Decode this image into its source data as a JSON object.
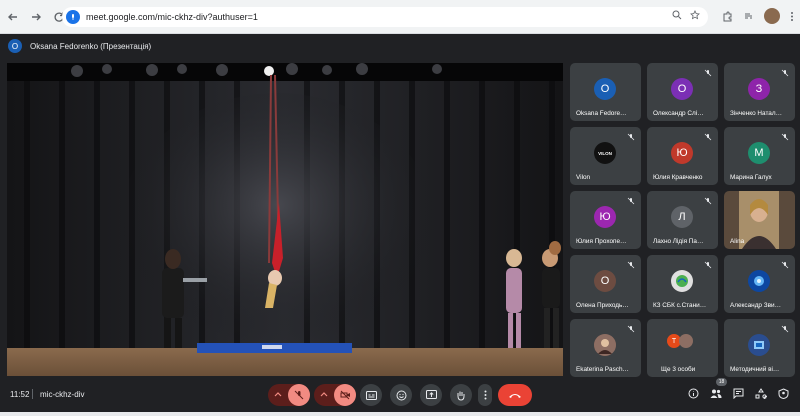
{
  "browser": {
    "url": "meet.google.com/mic-ckhz-div?authuser=1",
    "back_icon": "arrow-left-icon",
    "forward_icon": "arrow-right-icon",
    "reload_icon": "reload-icon"
  },
  "presenter": {
    "initial": "O",
    "label": "Oksana Fedorenko (Презентація)"
  },
  "participants": [
    {
      "initial": "O",
      "name": "Oksana Fedore…",
      "color": "#1a5fb4",
      "muted": false
    },
    {
      "initial": "O",
      "name": "Олександр Слі…",
      "color": "#7b2fb5",
      "muted": true
    },
    {
      "initial": "З",
      "name": "Зінченко Натал…",
      "color": "#8e24aa",
      "muted": true
    },
    {
      "initial": "VILON",
      "name": "Vilon",
      "color": "#111111",
      "muted": true
    },
    {
      "initial": "Ю",
      "name": "Юлия Кравченко",
      "color": "#c0392b",
      "muted": true
    },
    {
      "initial": "М",
      "name": "Марина Галух",
      "color": "#1e8e6e",
      "muted": true
    },
    {
      "initial": "Ю",
      "name": "Юлия Прохопе…",
      "color": "#9c27b0",
      "muted": true
    },
    {
      "initial": "Л",
      "name": "Лахно Лідія Па…",
      "color": "#5f6368",
      "muted": true
    },
    {
      "initial": "",
      "name": "Alina",
      "color": "#c9a27a",
      "muted": false
    },
    {
      "initial": "О",
      "name": "Олена Приходь…",
      "color": "#6d4c41",
      "muted": true
    },
    {
      "initial": "",
      "name": "КЗ СБК с.Стани…",
      "color": "#e0e0e0",
      "muted": true
    },
    {
      "initial": "",
      "name": "Александр Зви…",
      "color": "#0d47a1",
      "muted": true
    },
    {
      "initial": "",
      "name": "Ekaterina Pasch…",
      "color": "#6d4c41",
      "muted": true
    },
    {
      "initial": "Т",
      "name": "Ще 3 особи",
      "color": "#e64a19",
      "muted": false
    },
    {
      "initial": "",
      "name": "Методичний ві…",
      "color": "#2a4d8f",
      "muted": true
    }
  ],
  "meeting": {
    "time": "11:52",
    "code": "mic-ckhz-div",
    "participant_count": "18"
  }
}
